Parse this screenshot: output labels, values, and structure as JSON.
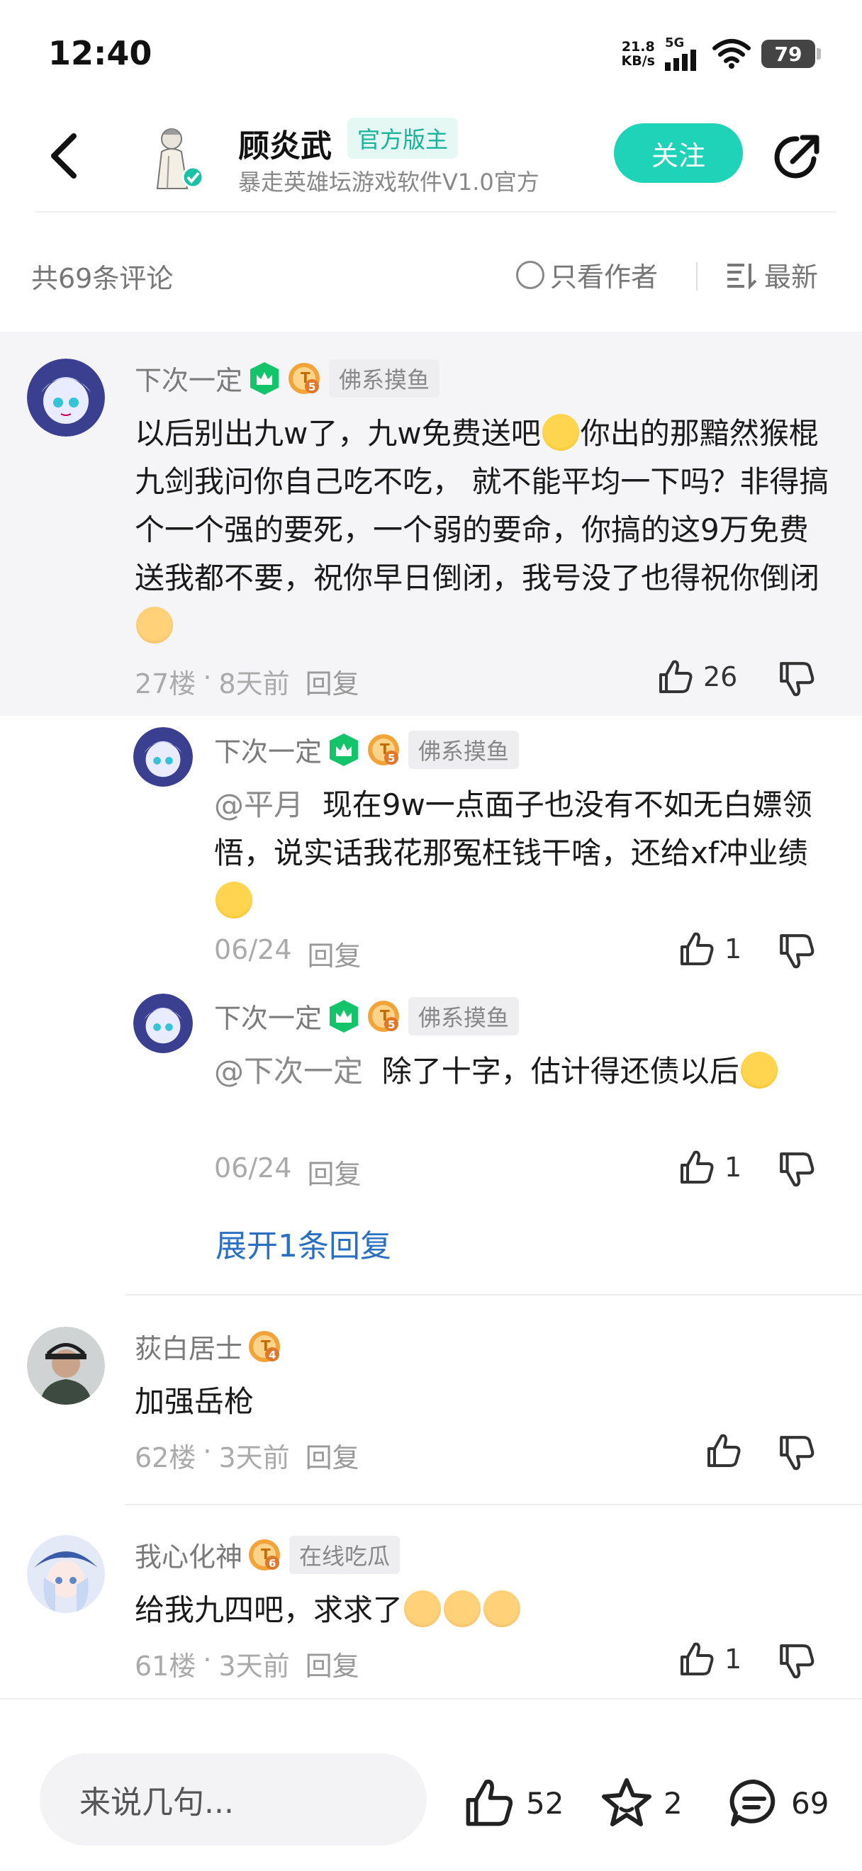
{
  "status_bar": {
    "time": "12:40",
    "net_speed_value": "21.8",
    "net_speed_unit": "KB/s",
    "network": "5G",
    "battery": "79"
  },
  "header": {
    "author_name": "顾炎武",
    "badge": "官方版主",
    "subtitle": "暴走英雄坛游戏软件V1.0官方",
    "follow_label": "关注"
  },
  "comment_bar": {
    "count": "共69条评论",
    "author_only": "只看作者",
    "sort": "最新"
  },
  "comments": [
    {
      "user": "下次一定",
      "level": "5",
      "tag": "佛系摸鱼",
      "text_1": "以后别出九w了，九w免费送吧",
      "text_2": "你出的那黯然猴棍九剑我问你自己吃不吃， 就不能平均一下吗？非得搞个一个强的要死，一个弱的要命，你搞的这9万免费送我都不要，祝你早日倒闭，我号没了也得祝你倒闭",
      "floor": "27楼",
      "dot": "·",
      "time": "8天前",
      "reply": "回复",
      "likes": "26",
      "replies": [
        {
          "user": "下次一定",
          "level": "5",
          "tag": "佛系摸鱼",
          "mention": "@平月",
          "text": "现在9w一点面子也没有不如无白嫖领悟，说实话我花那冤枉钱干啥，还给xf冲业绩",
          "date": "06/24",
          "reply": "回复",
          "likes": "1"
        },
        {
          "user": "下次一定",
          "level": "5",
          "tag": "佛系摸鱼",
          "mention": "@下次一定",
          "text": "除了十字，估计得还债以后",
          "date": "06/24",
          "reply": "回复",
          "likes": "1"
        }
      ],
      "expand": "展开1条回复"
    },
    {
      "user": "荻白居士",
      "level": "4",
      "text": "加强岳枪",
      "floor": "62楼",
      "dot": "·",
      "time": "3天前",
      "reply": "回复"
    },
    {
      "user": "我心化神",
      "level": "6",
      "tag": "在线吃瓜",
      "text": "给我九四吧，求求了",
      "floor": "61楼",
      "dot": "·",
      "time": "3天前",
      "reply": "回复",
      "likes": "1"
    }
  ],
  "bottom_bar": {
    "input_placeholder": "来说几句...",
    "likes": "52",
    "favorites": "2",
    "comments": "69"
  },
  "colors": {
    "accent": "#1fd3b8",
    "badge_text": "#19b39a",
    "link": "#2a6fc2",
    "level_green": "#14c46a",
    "level_gold": "#f2a33a"
  }
}
